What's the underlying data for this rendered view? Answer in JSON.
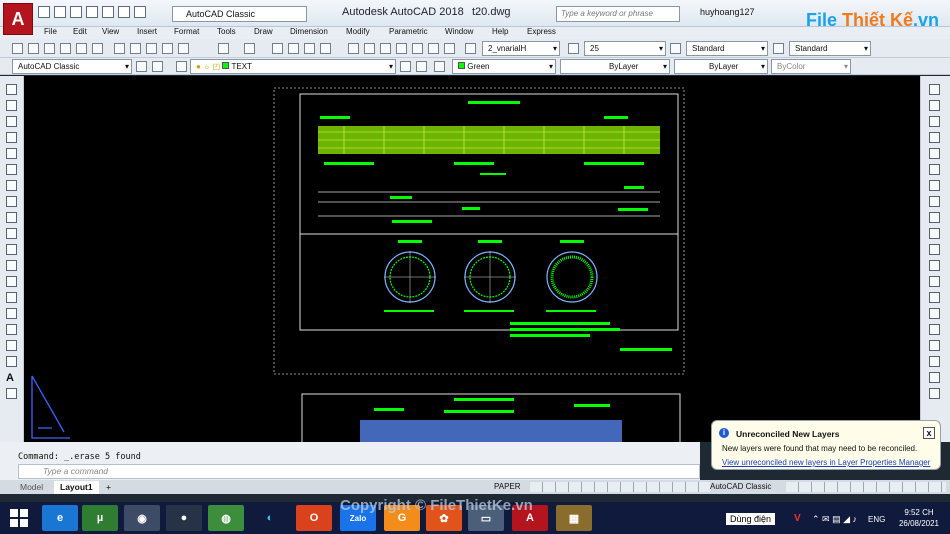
{
  "app": {
    "logo_letter": "A",
    "title": "Autodesk AutoCAD 2018",
    "file": "t20.dwg",
    "workspace": "AutoCAD Classic",
    "search_placeholder": "Type a keyword or phrase",
    "user": "huyhoang127",
    "brand_main": "File",
    "brand_accent": "Thiết Kế",
    "brand_suffix": ".vn"
  },
  "menu": [
    "File",
    "Edit",
    "View",
    "Insert",
    "Format",
    "Tools",
    "Draw",
    "Dimension",
    "Modify",
    "Parametric",
    "Window",
    "Help",
    "Express"
  ],
  "toolbar": {
    "dimstyle": "2_vnarialH",
    "text_height": "25",
    "text_style": "Standard",
    "table_style": "Standard",
    "workspace2": "AutoCAD Classic",
    "layer": "TEXT",
    "color": "Green",
    "linetype": "ByLayer",
    "lineweight": "ByLayer",
    "plotstyle": "ByColor"
  },
  "command": {
    "history": "Command:  _.erase 5 found",
    "placeholder": "Type a command"
  },
  "tabs": [
    "Model",
    "Layout1",
    "+"
  ],
  "status": {
    "space": "PAPER",
    "workspace": "AutoCAD Classic"
  },
  "notification": {
    "title": "Unreconciled New Layers",
    "body": "New layers were found that may need to be reconciled.",
    "link": "View unreconciled new layers in Layer Properties Manager",
    "close": "x"
  },
  "taskbar": {
    "zalo": "Zalo",
    "status_text": "Dùng điện",
    "lang": "ENG",
    "time": "9:52 CH",
    "date": "26/08/2021"
  },
  "watermark": "Copyright © FileThietKe.vn",
  "colors": {
    "cad_green": "#00ff00",
    "cad_bg": "#000000",
    "accent": "#b3141d"
  }
}
